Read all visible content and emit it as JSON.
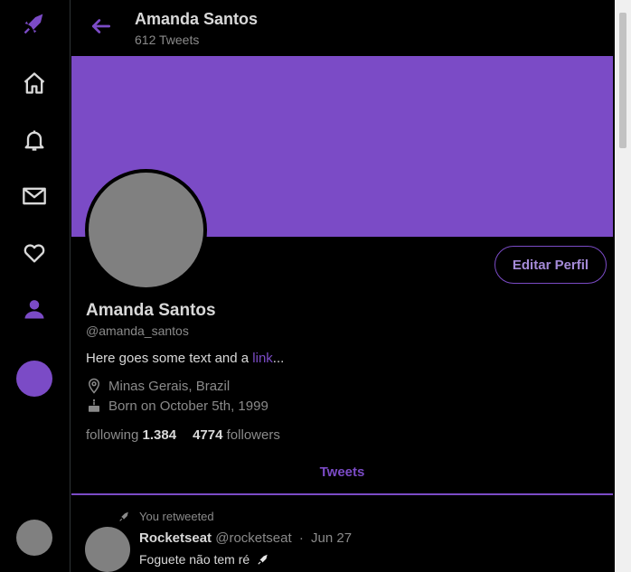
{
  "header": {
    "name": "Amanda Santos",
    "tweet_count": "612 Tweets"
  },
  "profile": {
    "name": "Amanda Santos",
    "handle": "@amanda_santos",
    "bio_text": "Here goes some text and a ",
    "bio_link": "link",
    "bio_tail": "...",
    "location": "Minas Gerais, Brazil",
    "birthday": "Born on October 5th, 1999",
    "following_label": "following",
    "following_count": "1.384",
    "followers_count": "4774",
    "followers_label": "followers",
    "edit_button": "Editar Perfil"
  },
  "tabs": {
    "active": "Tweets"
  },
  "tweet": {
    "retweet_label": "You retweeted",
    "author": "Rocketseat",
    "handle": "@rocketseat",
    "separator": "·",
    "date": "Jun 27",
    "text": "Foguete não tem ré"
  },
  "colors": {
    "accent": "#7b4bc6",
    "background": "#000000",
    "avatar": "#808080"
  },
  "icons": {
    "logo": "rocket-icon",
    "home": "home-icon",
    "notifications": "bell-icon",
    "messages": "mail-icon",
    "favorites": "heart-icon",
    "profile": "user-icon",
    "back": "arrow-left-icon",
    "location": "location-pin-icon",
    "birthday": "cake-icon",
    "retweet": "rocket-icon"
  }
}
